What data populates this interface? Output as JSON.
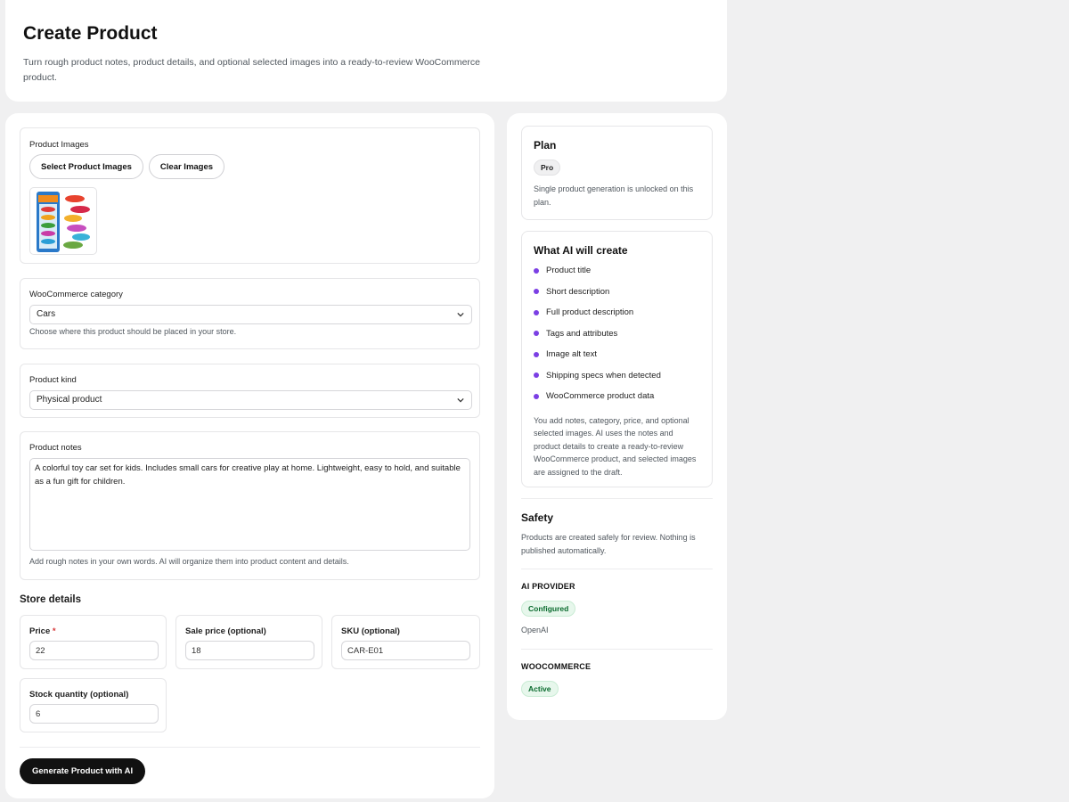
{
  "header": {
    "title": "Create Product",
    "subtitle": "Turn rough product notes, product details, and optional selected images into a ready-to-review WooCommerce product."
  },
  "images": {
    "label": "Product Images",
    "select_button": "Select Product Images",
    "clear_button": "Clear Images",
    "thumbnail_alt": "toy cars pack"
  },
  "category": {
    "label": "WooCommerce category",
    "value": "Cars",
    "help": "Choose where this product should be placed in your store."
  },
  "kind": {
    "label": "Product kind",
    "value": "Physical product"
  },
  "notes": {
    "label": "Product notes",
    "value": "A colorful toy car set for kids. Includes small cars for creative play at home. Lightweight, easy to hold, and suitable as a fun gift for children.",
    "help": "Add rough notes in your own words. AI will organize them into product content and details."
  },
  "store": {
    "title": "Store details",
    "price_label": "Price",
    "required_mark": "*",
    "price_value": "22",
    "sale_label": "Sale price (optional)",
    "sale_value": "18",
    "sku_label": "SKU (optional)",
    "sku_value": "CAR-E01",
    "stock_label": "Stock quantity (optional)",
    "stock_value": "6"
  },
  "generate_button": "Generate Product with AI",
  "plan": {
    "title": "Plan",
    "badge": "Pro",
    "text": "Single product generation is unlocked on this plan."
  },
  "ai_create": {
    "title": "What AI will create",
    "items": [
      "Product title",
      "Short description",
      "Full product description",
      "Tags and attributes",
      "Image alt text",
      "Shipping specs when detected",
      "WooCommerce product data"
    ],
    "text": "You add notes, category, price, and optional selected images. AI uses the notes and product details to create a ready-to-review WooCommerce product, and selected images are assigned to the draft."
  },
  "safety": {
    "title": "Safety",
    "text": "Products are created safely for review. Nothing is published automatically."
  },
  "provider": {
    "label": "AI PROVIDER",
    "status": "Configured",
    "name": "OpenAI"
  },
  "woocommerce": {
    "label": "WOOCOMMERCE",
    "status": "Active"
  },
  "colors": {
    "accent_dot": "#7b3fe4",
    "primary_button": "#111111",
    "page_bg": "#f0f0f1",
    "green_badge": "#e7f7ec"
  }
}
